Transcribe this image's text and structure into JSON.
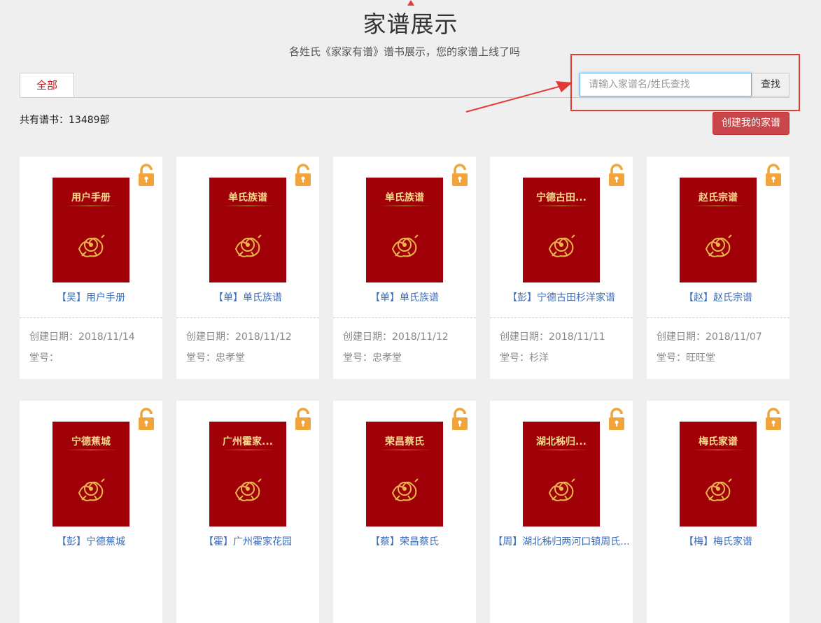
{
  "page": {
    "title": "家谱展示",
    "subtitle": "各姓氏《家家有谱》谱书展示，您的家谱上线了吗"
  },
  "tabs": [
    {
      "label": "全部",
      "active": true
    }
  ],
  "search": {
    "placeholder": "请输入家谱名/姓氏查找",
    "button_label": "查找"
  },
  "summary": {
    "book_count_text": "共有谱书：13489部"
  },
  "create_button_label": "创建我的家谱",
  "colors": {
    "accent": "#c0141a",
    "cover": "#a00008",
    "cover_text": "#f3d98a",
    "link": "#3b6db6",
    "lock": "#f0a43a",
    "highlight": "#e53935"
  },
  "books": [
    {
      "cover_title": "用户手册",
      "name": "【吴】用户手册",
      "created": "创建日期：2018/11/14",
      "hall": "堂号："
    },
    {
      "cover_title": "单氏族谱",
      "name": "【单】单氏族谱",
      "created": "创建日期：2018/11/12",
      "hall": "堂号：忠孝堂"
    },
    {
      "cover_title": "单氏族谱",
      "name": "【单】单氏族谱",
      "created": "创建日期：2018/11/12",
      "hall": "堂号：忠孝堂"
    },
    {
      "cover_title": "宁德古田...",
      "name": "【彭】宁德古田杉洋家谱",
      "created": "创建日期：2018/11/11",
      "hall": "堂号：杉洋"
    },
    {
      "cover_title": "赵氏宗谱",
      "name": "【赵】赵氏宗谱",
      "created": "创建日期：2018/11/07",
      "hall": "堂号：旺旺堂"
    },
    {
      "cover_title": "宁德蕉城",
      "name": "【彭】宁德蕉城",
      "created": "",
      "hall": ""
    },
    {
      "cover_title": "广州霍家...",
      "name": "【霍】广州霍家花园",
      "created": "",
      "hall": ""
    },
    {
      "cover_title": "荣昌蔡氏",
      "name": "【蔡】荣昌蔡氏",
      "created": "",
      "hall": ""
    },
    {
      "cover_title": "湖北秭归...",
      "name": "【周】湖北秭归两河口镇周氏...",
      "created": "",
      "hall": ""
    },
    {
      "cover_title": "梅氏家谱",
      "name": "【梅】梅氏家谱",
      "created": "",
      "hall": ""
    }
  ]
}
